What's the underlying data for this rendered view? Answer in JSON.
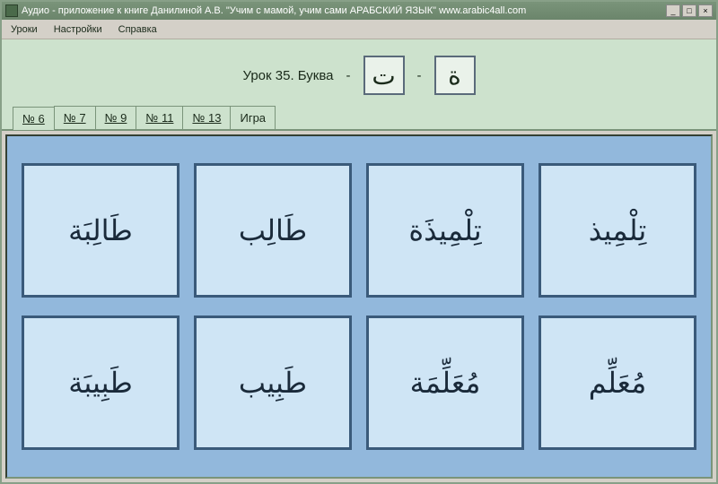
{
  "titlebar": {
    "text": "Аудио - приложение к книге   Данилиной А.В.  \"Учим с мамой, учим сами АРАБСКИЙ ЯЗЫК\"      www.arabic4all.com"
  },
  "menubar": {
    "items": [
      "Уроки",
      "Настройки",
      "Справка"
    ]
  },
  "lesson": {
    "label": "Урок 35.  Буква",
    "sep1": "-",
    "letter1": "ت",
    "sep2": "-",
    "letter2": "ة"
  },
  "tabs": [
    {
      "label": "№ 6",
      "active": true
    },
    {
      "label": "№ 7",
      "active": false
    },
    {
      "label": "№ 9",
      "active": false
    },
    {
      "label": "№ 11",
      "active": false
    },
    {
      "label": "№ 13",
      "active": false
    },
    {
      "label": "Игра",
      "active": false,
      "no_underline": true
    }
  ],
  "cards": [
    "طَالِبَة",
    "طَالِب",
    "تِلْمِيذَة",
    "تِلْمِيذ",
    "طَبِيبَة",
    "طَبِيب",
    "مُعَلِّمَة",
    "مُعَلِّم"
  ]
}
